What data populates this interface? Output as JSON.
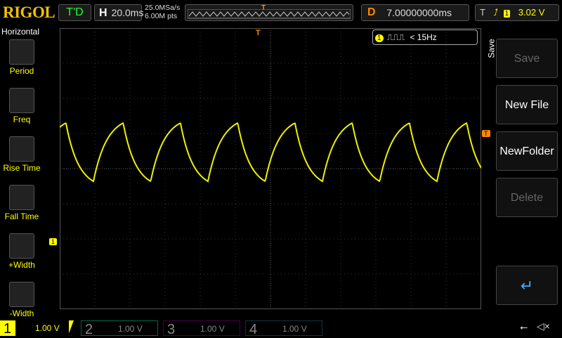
{
  "header": {
    "logo": "RIGOL",
    "trigger_status": "T'D",
    "h_label": "H",
    "timebase": "20.0ms",
    "sample_rate": "25.0MSa/s",
    "memory_depth": "6.00M pts",
    "delay_label": "D",
    "delay": "7.00000000ms",
    "trig_label": "T",
    "trig_channel": "1",
    "trig_level": "3.02 V"
  },
  "left_menu": {
    "title": "Horizontal",
    "items": [
      {
        "label": "Period"
      },
      {
        "label": "Freq"
      },
      {
        "label": "Rise Time"
      },
      {
        "label": "Fall Time"
      },
      {
        "label": "+Width"
      },
      {
        "label": "-Width"
      }
    ]
  },
  "right_menu": {
    "title": "Save",
    "items": [
      {
        "label": "Save",
        "enabled": false
      },
      {
        "label": "New File",
        "enabled": true
      },
      {
        "label": "NewFolder",
        "enabled": true
      },
      {
        "label": "Delete",
        "enabled": false
      }
    ]
  },
  "freq_counter": {
    "channel": "1",
    "value": "< 15Hz"
  },
  "markers": {
    "trigger": "T",
    "channel": "1"
  },
  "channels": [
    {
      "num": "1",
      "scale": "1.00 V",
      "color": "#f0f000"
    },
    {
      "num": "2",
      "scale": "1.00 V",
      "color": "#00c0a0"
    },
    {
      "num": "3",
      "scale": "1.00 V",
      "color": "#c000c0"
    },
    {
      "num": "4",
      "scale": "1.00 V",
      "color": "#2080ff"
    }
  ],
  "colors": {
    "ch1": "#f0f000",
    "accent": "#ff8000"
  }
}
